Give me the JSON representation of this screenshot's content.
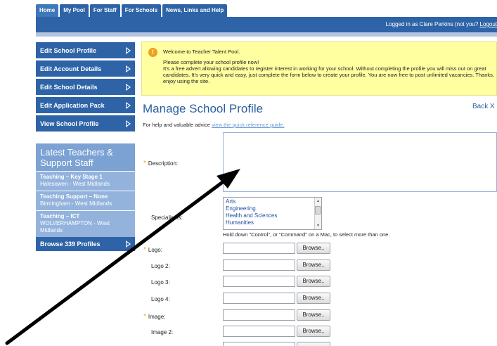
{
  "tabs": [
    "Home",
    "My Pool",
    "For Staff",
    "For Schools",
    "News, Links and Help"
  ],
  "header": {
    "login_text": "Logged in as Clare Perkins (not you? ",
    "logout_label": "Logout"
  },
  "sidebar": {
    "items": [
      {
        "label": "Edit School Profile"
      },
      {
        "label": "Edit Account Details"
      },
      {
        "label": "Edit School Details"
      },
      {
        "label": "Edit Application Pack"
      },
      {
        "label": "View School Profile"
      }
    ],
    "latest_title": "Latest Teachers & Support Staff",
    "teachers": [
      {
        "title": "Teaching – Key Stage 1",
        "location": "Halesowen - West Midlands"
      },
      {
        "title": "Teaching Support – None",
        "location": "Birmingham - West Midlands"
      },
      {
        "title": "Teaching – ICT",
        "location": "WOLVERHAMPTON - West Midlands"
      }
    ],
    "browse_label": "Browse 339 Profiles"
  },
  "notice": {
    "welcome": "Welcome to Teacher Talent Pool.",
    "line1": "Please complete your school profile now!",
    "body": "It's a free advert allowing candidates to register interest in working for your school. Without completing the profile you will miss out on great candidates. It's very quick and easy, just complete the form below to create your profile. You are now free to post unlimited vacancies. Thanks, enjoy using the site."
  },
  "main": {
    "title": "Manage School Profile",
    "back_label": "Back X",
    "help_prefix": "For help and valuable advice ",
    "help_link": "view the quick reference guide."
  },
  "form": {
    "description_label": "Description:",
    "specialisms_label": "Specialisms:",
    "specialisms_options": [
      "Arts",
      "Engineering",
      "Health and Sciences",
      "Humanities"
    ],
    "hold_hint": "Hold down \"Control\", or \"Command\" on a Mac, to select more than one.",
    "browse_label": "Browse..",
    "file_fields": [
      {
        "label": "Logo:",
        "required": true
      },
      {
        "label": "Logo 2:",
        "required": false
      },
      {
        "label": "Logo 3:",
        "required": false
      },
      {
        "label": "Logo 4:",
        "required": false
      },
      {
        "label": "Image:",
        "required": true
      },
      {
        "label": "Image 2:",
        "required": false
      }
    ]
  },
  "colors": {
    "primary": "#2e64a7",
    "notice": "#ffffa0",
    "accent_star": "#f2a81d"
  }
}
